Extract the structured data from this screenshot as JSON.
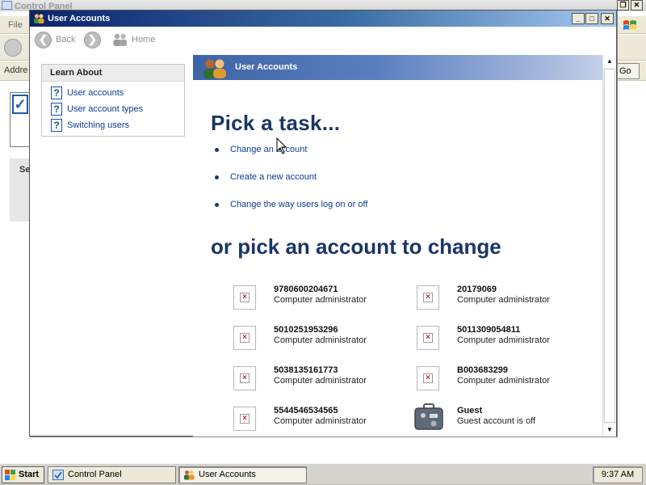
{
  "background_window": {
    "title": "Control Panel",
    "menu_file": "File",
    "address_label": "Addre",
    "go_label": "Go",
    "side_label": "Se"
  },
  "window": {
    "title": "User Accounts",
    "caption_buttons": {
      "minimize": "_",
      "maximize": "□",
      "close": "✕"
    }
  },
  "toolbar": {
    "back_label": "Back",
    "home_label": "Home"
  },
  "sidebar": {
    "header": "Learn About",
    "items": [
      {
        "label": "User accounts",
        "icon": "help-icon"
      },
      {
        "label": "User account types",
        "icon": "help-icon"
      },
      {
        "label": "Switching users",
        "icon": "help-icon"
      }
    ]
  },
  "main": {
    "band_title": "User Accounts",
    "pick_task_heading": "Pick a task...",
    "tasks": [
      "Change an account",
      "Create a new account",
      "Change the way users log on or off"
    ],
    "pick_account_heading": "or pick an account to change",
    "accounts": [
      {
        "name": "9780600204671",
        "type": "Computer administrator"
      },
      {
        "name": "20179069",
        "type": "Computer administrator"
      },
      {
        "name": "5010251953296",
        "type": "Computer administrator"
      },
      {
        "name": "5011309054811",
        "type": "Computer administrator"
      },
      {
        "name": "5038135161773",
        "type": "Computer administrator"
      },
      {
        "name": "B003683299",
        "type": "Computer administrator"
      },
      {
        "name": "5544546534565",
        "type": "Computer administrator"
      },
      {
        "name": "Guest",
        "type": "Guest account is off"
      }
    ]
  },
  "taskbar": {
    "start_label": "Start",
    "buttons": [
      "Control Panel",
      "User Accounts"
    ],
    "clock": "9:37 AM"
  },
  "colors": {
    "title_bar": "#0a246a",
    "heading": "#1b3566",
    "link": "#0b3d91",
    "band": "#3d64a6"
  }
}
